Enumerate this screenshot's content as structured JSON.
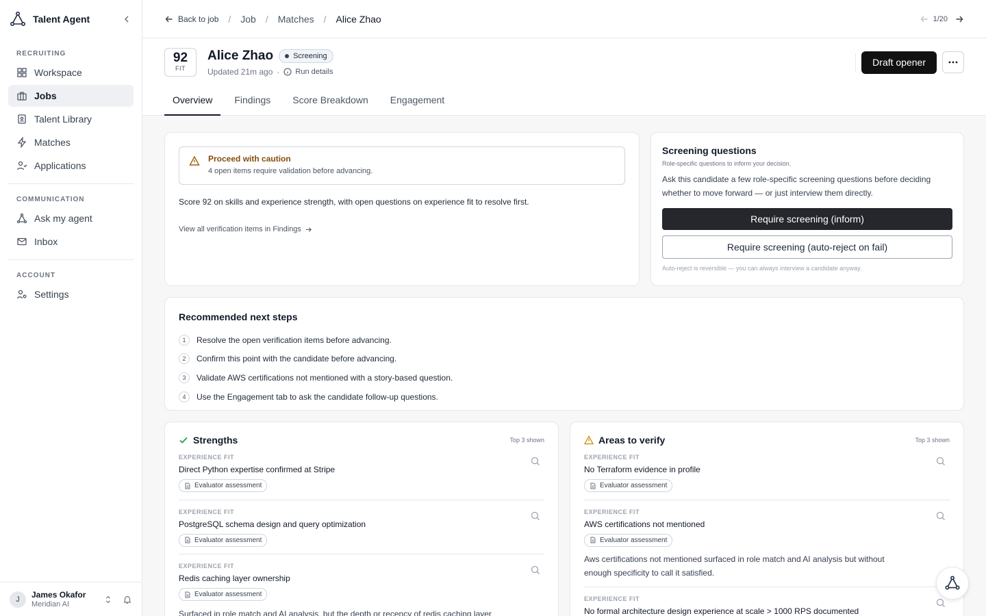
{
  "app": {
    "name": "Talent Agent"
  },
  "sidebar": {
    "sections": [
      {
        "label": "RECRUITING",
        "items": [
          "Workspace",
          "Jobs",
          "Talent Library",
          "Matches",
          "Applications"
        ]
      },
      {
        "label": "COMMUNICATION",
        "items": [
          "Ask my agent",
          "Inbox"
        ]
      },
      {
        "label": "ACCOUNT",
        "items": [
          "Settings"
        ]
      }
    ],
    "active": "Jobs"
  },
  "user": {
    "name": "James Okafor",
    "org": "Meridian AI",
    "initial": "J"
  },
  "breadcrumb": {
    "back": "Back to job",
    "items": [
      "Job",
      "Matches",
      "Alice Zhao"
    ]
  },
  "pager": {
    "label": "1/20"
  },
  "candidate": {
    "score": "92",
    "score_label": "FIT",
    "name": "Alice Zhao",
    "status": "Screening",
    "updated": "Updated 21m ago",
    "run_details": "Run details"
  },
  "actions": {
    "draft": "Draft opener"
  },
  "tabs": [
    "Overview",
    "Findings",
    "Score Breakdown",
    "Engagement"
  ],
  "summary": {
    "caution_title": "Proceed with caution",
    "caution_text": "4 open items require validation before advancing.",
    "text": "Score 92 on skills and experience strength, with open questions on experience fit to resolve first.",
    "view_all": "View all verification items in Findings"
  },
  "screening": {
    "title": "Screening questions",
    "subtitle": "Role-specific questions to inform your decision.",
    "description": "Ask this candidate a few role-specific screening questions before deciding whether to move forward — or just interview them directly.",
    "button_inform": "Require screening (inform)",
    "button_reject": "Require screening (auto-reject on fail)",
    "note": "Auto-reject is reversible — you can always interview a candidate anyway."
  },
  "next_steps": {
    "title": "Recommended next steps",
    "items": [
      "Resolve the open verification items before advancing.",
      "Confirm this point with the candidate before advancing.",
      "Validate AWS certifications not mentioned with a story-based question.",
      "Use the Engagement tab to ask the candidate follow-up questions."
    ]
  },
  "strengths": {
    "title": "Strengths",
    "meta": "Top 3 shown",
    "items": [
      {
        "category": "EXPERIENCE FIT",
        "title": "Direct Python expertise confirmed at Stripe",
        "chip": "Evaluator assessment",
        "desc": ""
      },
      {
        "category": "EXPERIENCE FIT",
        "title": "PostgreSQL schema design and query optimization",
        "chip": "Evaluator assessment",
        "desc": ""
      },
      {
        "category": "EXPERIENCE FIT",
        "title": "Redis caching layer ownership",
        "chip": "Evaluator assessment",
        "desc": "Surfaced in role match and AI analysis, but the depth or recency of redis caching layer"
      }
    ]
  },
  "verify": {
    "title": "Areas to verify",
    "meta": "Top 3 shown",
    "items": [
      {
        "category": "EXPERIENCE FIT",
        "title": "No Terraform evidence in profile",
        "chip": "Evaluator assessment",
        "desc": ""
      },
      {
        "category": "EXPERIENCE FIT",
        "title": "AWS certifications not mentioned",
        "chip": "Evaluator assessment",
        "desc": "Aws certifications not mentioned surfaced in role match and AI analysis but without enough specificity to call it satisfied."
      },
      {
        "category": "EXPERIENCE FIT",
        "title": "No formal architecture design experience at scale > 1000 RPS documented",
        "chip": "",
        "desc": ""
      }
    ]
  },
  "colors": {
    "accent": "#111111",
    "caution": "#854d0e",
    "strength": "#16a34a",
    "verify": "#ca8a04"
  }
}
